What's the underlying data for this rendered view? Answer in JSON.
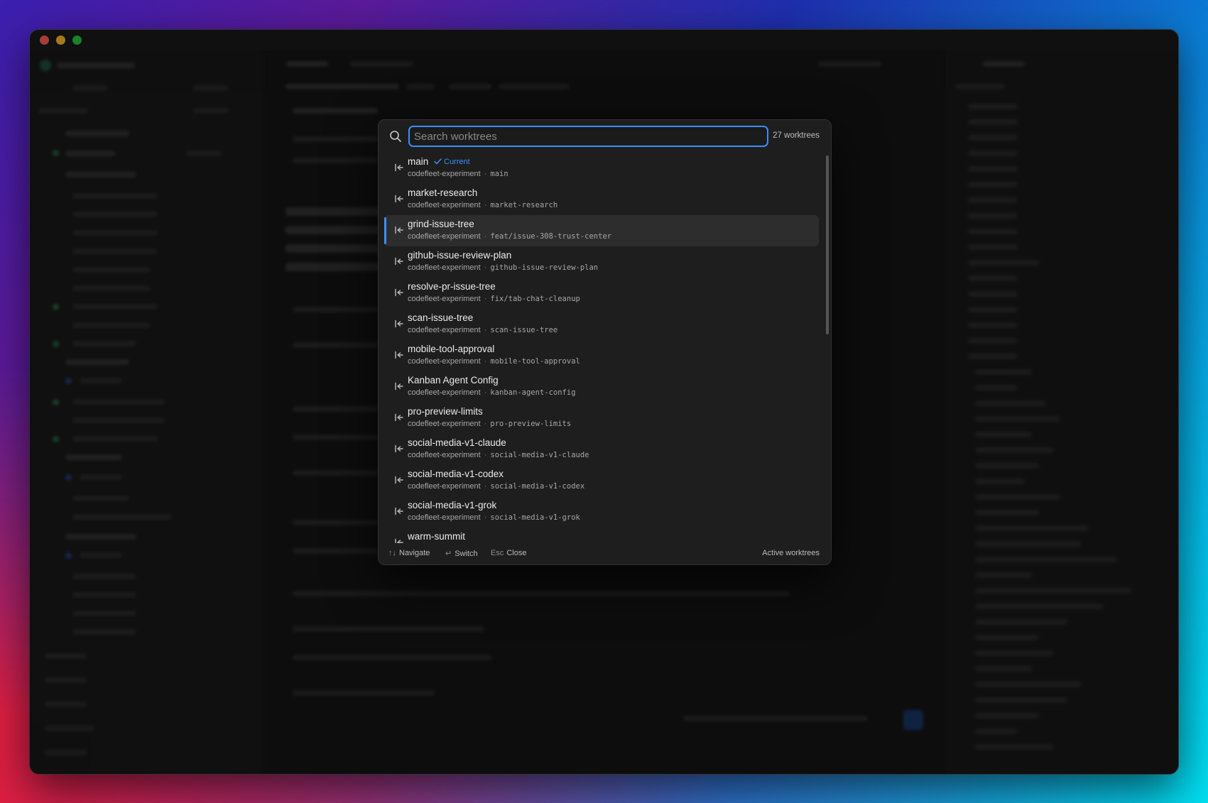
{
  "search": {
    "placeholder": "Search worktrees",
    "value": "",
    "count_label": "27 worktrees"
  },
  "worktrees": [
    {
      "name": "main",
      "repo": "codefleet-experiment",
      "branch": "main",
      "current": true,
      "current_label": "Current"
    },
    {
      "name": "market-research",
      "repo": "codefleet-experiment",
      "branch": "market-research"
    },
    {
      "name": "grind-issue-tree",
      "repo": "codefleet-experiment",
      "branch": "feat/issue-308-trust-center",
      "selected": true
    },
    {
      "name": "github-issue-review-plan",
      "repo": "codefleet-experiment",
      "branch": "github-issue-review-plan"
    },
    {
      "name": "resolve-pr-issue-tree",
      "repo": "codefleet-experiment",
      "branch": "fix/tab-chat-cleanup"
    },
    {
      "name": "scan-issue-tree",
      "repo": "codefleet-experiment",
      "branch": "scan-issue-tree"
    },
    {
      "name": "mobile-tool-approval",
      "repo": "codefleet-experiment",
      "branch": "mobile-tool-approval"
    },
    {
      "name": "Kanban Agent Config",
      "repo": "codefleet-experiment",
      "branch": "kanban-agent-config"
    },
    {
      "name": "pro-preview-limits",
      "repo": "codefleet-experiment",
      "branch": "pro-preview-limits"
    },
    {
      "name": "social-media-v1-claude",
      "repo": "codefleet-experiment",
      "branch": "social-media-v1-claude"
    },
    {
      "name": "social-media-v1-codex",
      "repo": "codefleet-experiment",
      "branch": "social-media-v1-codex"
    },
    {
      "name": "social-media-v1-grok",
      "repo": "codefleet-experiment",
      "branch": "social-media-v1-grok"
    },
    {
      "name": "warm-summit",
      "repo": "",
      "branch": ""
    }
  ],
  "footer": {
    "navigate_key": "↑↓",
    "navigate_label": "Navigate",
    "switch_key": "↵",
    "switch_label": "Switch",
    "close_key": "Esc",
    "close_label": "Close",
    "scope_label": "Active worktrees"
  },
  "icons": {
    "search": "search-icon",
    "worktree": "worktree-enter-icon",
    "check": "check-icon"
  },
  "colors": {
    "accent": "#3b8ff7",
    "modal_bg": "#1e1e1e",
    "selected_row": "#2d2d2d"
  }
}
